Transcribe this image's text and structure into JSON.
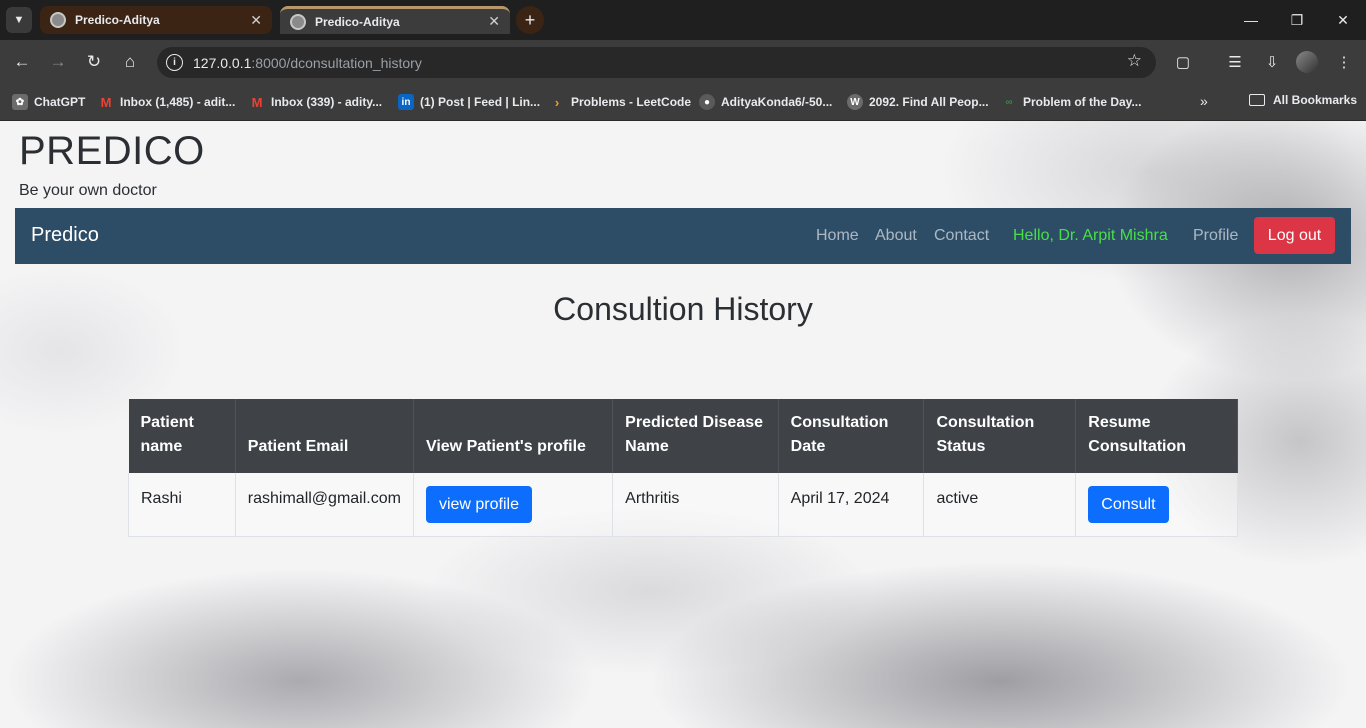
{
  "browser": {
    "tabs": [
      {
        "title": "Predico-Aditya"
      },
      {
        "title": "Predico-Aditya"
      }
    ],
    "url_host": "127.0.0.1",
    "url_path": ":8000/dconsultation_history",
    "bookmarks": [
      {
        "label": "ChatGPT",
        "icon": "chatgpt-icon"
      },
      {
        "label": "Inbox (1,485) - adit...",
        "icon": "gmail-icon"
      },
      {
        "label": "Inbox (339) - adity...",
        "icon": "gmail-icon"
      },
      {
        "label": "(1) Post | Feed | Lin...",
        "icon": "linkedin-icon"
      },
      {
        "label": "Problems - LeetCode",
        "icon": "leetcode-icon"
      },
      {
        "label": "AdityaKonda6/-50...",
        "icon": "github-icon"
      },
      {
        "label": "2092. Find All Peop...",
        "icon": "leetcode-w-icon"
      },
      {
        "label": "Problem of the Day...",
        "icon": "gfg-icon"
      }
    ],
    "all_bookmarks": "All Bookmarks"
  },
  "site": {
    "title": "PREDICO",
    "tagline": "Be your own doctor"
  },
  "navbar": {
    "brand": "Predico",
    "links": [
      "Home",
      "About",
      "Contact"
    ],
    "greeting": "Hello, Dr. Arpit Mishra",
    "profile": "Profile",
    "logout": "Log out"
  },
  "page_heading": "Consultion History",
  "table": {
    "headers": [
      "Patient name",
      "Patient Email",
      "View Patient's profile",
      "Predicted Disease Name",
      "Consultation Date",
      "Consultation Status",
      "Resume Consultation"
    ],
    "rows": [
      {
        "patient_name": "Rashi",
        "email": "rashimall@gmail.com",
        "view_profile_label": "view profile",
        "disease": "Arthritis",
        "date": "April 17, 2024",
        "status": "active",
        "consult_label": "Consult"
      }
    ]
  },
  "colors": {
    "navbar_bg": "#2d4c66",
    "greeting": "#46e046",
    "logout_bg": "#dc3545",
    "primary_btn": "#0d6efd",
    "table_header_bg": "#3f4348"
  }
}
